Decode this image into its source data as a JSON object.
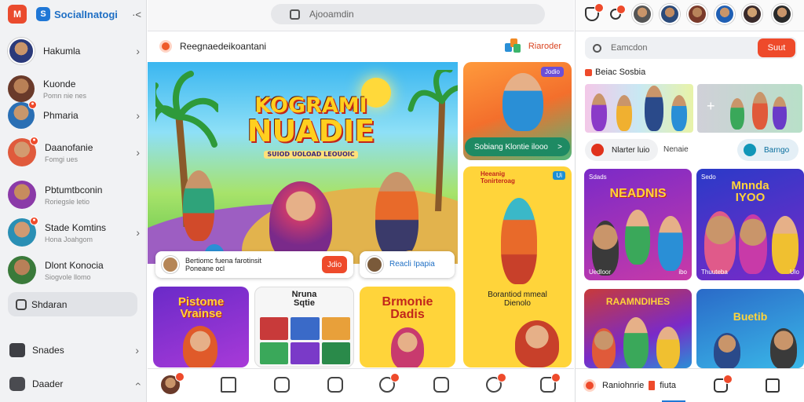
{
  "app": {
    "name": "SocialInatogi",
    "menu_glyph": "·<"
  },
  "sidebar": {
    "profile": {
      "name": "Hakumla"
    },
    "contacts": [
      {
        "name": "Kuonde",
        "sub": "Pomn nie nes"
      },
      {
        "name": "Phmaria",
        "sub": ""
      },
      {
        "name": "Daanofanie",
        "sub": "Fomgi ues"
      },
      {
        "name": "Pbtumtbconin",
        "sub": "Roriegsle letio"
      },
      {
        "name": "Stade Komtins",
        "sub": "Hona Joahgom"
      },
      {
        "name": "Dlont Konocia",
        "sub": "Siogvole llomo"
      }
    ],
    "active_item": "Shdaran",
    "rows": [
      {
        "label": "Snades"
      },
      {
        "label": "Daader"
      }
    ]
  },
  "topbar": {
    "search_placeholder": "Ajooamdin"
  },
  "feed": {
    "title": "Reegnaedeikoantani",
    "right_label": "Riaroder",
    "hero": {
      "line1": "KOGRAMI",
      "line2": "NUADIE",
      "line3": "SUIOD UOLOAD LEOUOIC",
      "card_left": {
        "line1": "Bertiomc fuena farotinsit",
        "line2": "Poneane ocl",
        "button": "Jdio"
      },
      "card_right": {
        "text": "Reacli   Ipapia"
      }
    },
    "side_top": {
      "badge": "Jodio",
      "pill": "Sobiang Klontie ilooo",
      "arrow": ">"
    },
    "side_yellow": {
      "label": "Heeanig\nTonirteroag",
      "badge": "Ui",
      "caption": "Borantiod mmeal\nDienolo"
    },
    "tiles": [
      {
        "line1": "Pistome",
        "line2": "Vrainse"
      },
      {
        "line1": "Nruna",
        "line2": "Sqtie"
      },
      {
        "line1": "Brmonie",
        "line2": "Dadis"
      }
    ]
  },
  "right": {
    "search_placeholder": "Eamcdon",
    "search_button": "Suut",
    "section_title": "Beiac Sosbia",
    "chip_left": "Nlarter luio",
    "chip_mid": "Nenaie",
    "chip_right": "Barngo",
    "cards": [
      {
        "tag": "Sdads",
        "head": "NEADNIS",
        "meta_l": "Uedloor",
        "meta_r": "ibo"
      },
      {
        "tag": "Sedo",
        "head": "Mnnda\nIYOO",
        "meta_l": "Thuuteba",
        "meta_r": "Ulo"
      },
      {
        "tag": "",
        "head": "RAAMNDIHES",
        "meta_l": "",
        "meta_r": ""
      },
      {
        "tag": "",
        "head": "Buetib",
        "meta_l": "",
        "meta_r": ""
      }
    ],
    "bottom_tab": {
      "label_a": "Raniohnrie",
      "label_b": "fiuta"
    }
  },
  "colors": {
    "accent": "#ee4a2b",
    "brand_blue": "#1f77d6",
    "sidebar_bg": "#f1f2f4"
  }
}
